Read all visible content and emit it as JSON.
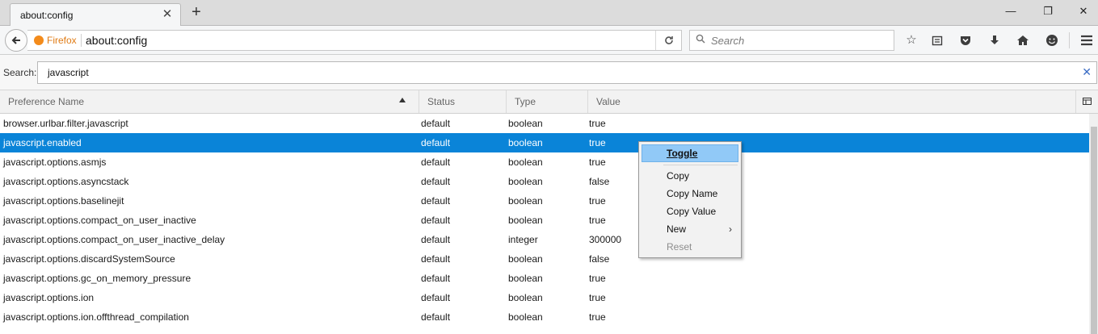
{
  "tabs": [
    {
      "title": "about:config",
      "close": "✕"
    }
  ],
  "newtab": "+",
  "window_controls": {
    "minimize": "—",
    "restore": "❐",
    "close": "✕"
  },
  "navbar": {
    "identity_label": "Firefox",
    "url": "about:config",
    "search_placeholder": "Search"
  },
  "filter": {
    "label": "Search:",
    "value": "javascript"
  },
  "columns": [
    "Preference Name",
    "Status",
    "Type",
    "Value"
  ],
  "sort_column": "Preference Name",
  "rows": [
    {
      "name": "browser.urlbar.filter.javascript",
      "status": "default",
      "type": "boolean",
      "value": "true"
    },
    {
      "name": "javascript.enabled",
      "status": "default",
      "type": "boolean",
      "value": "true",
      "selected": true
    },
    {
      "name": "javascript.options.asmjs",
      "status": "default",
      "type": "boolean",
      "value": "true"
    },
    {
      "name": "javascript.options.asyncstack",
      "status": "default",
      "type": "boolean",
      "value": "false"
    },
    {
      "name": "javascript.options.baselinejit",
      "status": "default",
      "type": "boolean",
      "value": "true"
    },
    {
      "name": "javascript.options.compact_on_user_inactive",
      "status": "default",
      "type": "boolean",
      "value": "true"
    },
    {
      "name": "javascript.options.compact_on_user_inactive_delay",
      "status": "default",
      "type": "integer",
      "value": "300000"
    },
    {
      "name": "javascript.options.discardSystemSource",
      "status": "default",
      "type": "boolean",
      "value": "false"
    },
    {
      "name": "javascript.options.gc_on_memory_pressure",
      "status": "default",
      "type": "boolean",
      "value": "true"
    },
    {
      "name": "javascript.options.ion",
      "status": "default",
      "type": "boolean",
      "value": "true"
    },
    {
      "name": "javascript.options.ion.offthread_compilation",
      "status": "default",
      "type": "boolean",
      "value": "true"
    }
  ],
  "context_menu": {
    "items": [
      {
        "label": "Toggle",
        "highlighted": true
      },
      {
        "label": "Copy"
      },
      {
        "label": "Copy Name"
      },
      {
        "label": "Copy Value"
      },
      {
        "label": "New",
        "submenu": "›"
      },
      {
        "label": "Reset",
        "disabled": true
      }
    ]
  },
  "colors": {
    "selection": "#0a84d8",
    "menu_highlight": "#91c9f7",
    "firefox_orange": "#f38b1b"
  },
  "icons": [
    "back-arrow-icon",
    "firefox-logo-icon",
    "reload-icon",
    "search-icon",
    "bookmark-star-icon",
    "reading-list-icon",
    "pocket-icon",
    "download-icon",
    "home-icon",
    "smiley-icon",
    "hamburger-menu-icon",
    "column-picker-icon"
  ]
}
